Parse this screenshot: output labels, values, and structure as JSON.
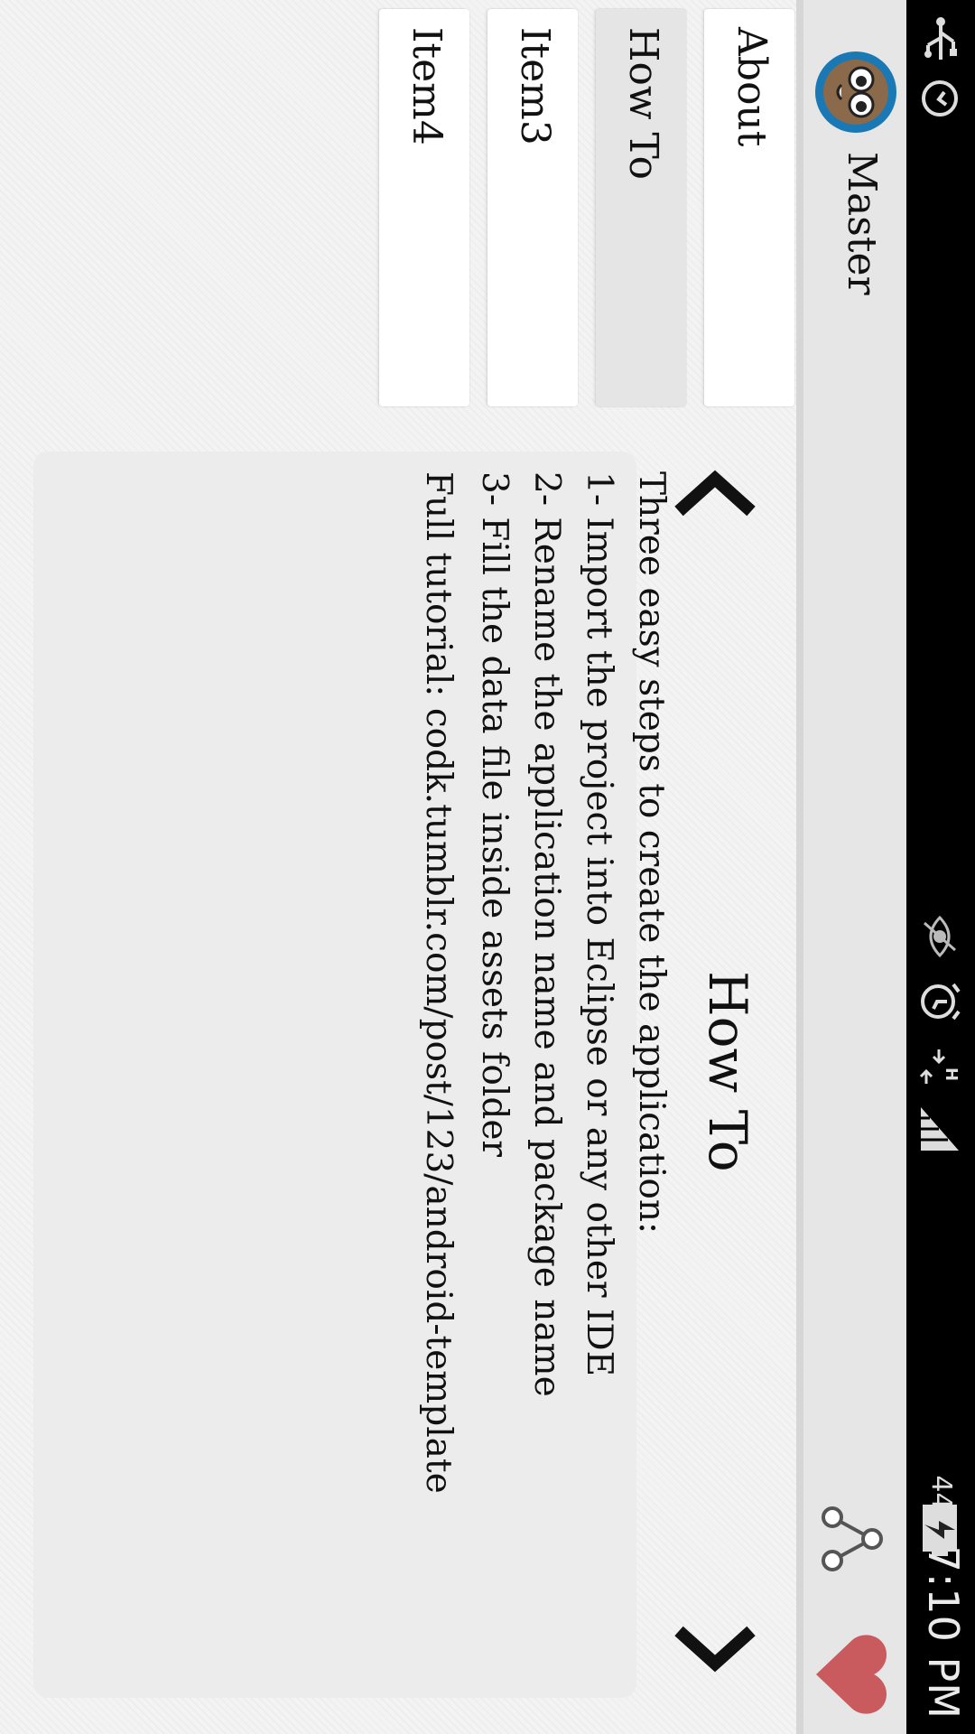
{
  "status_bar": {
    "time": "7:10 PM",
    "battery_percent": "44%",
    "network_type": "H",
    "icons": [
      "usb-icon",
      "sync-icon",
      "eye-icon",
      "alarm-icon",
      "data-arrows-icon",
      "signal-icon",
      "battery-charging-icon"
    ]
  },
  "action_bar": {
    "title": "Master",
    "logo_icon": "owl-logo-icon",
    "actions": [
      "share-icon",
      "favorite-heart-icon"
    ],
    "heart_color": "#c95a5e"
  },
  "drawer": {
    "items": [
      {
        "label": "About",
        "selected": false
      },
      {
        "label": "How To",
        "selected": true
      },
      {
        "label": "Item3",
        "selected": false
      },
      {
        "label": "Item4",
        "selected": false
      }
    ]
  },
  "content": {
    "title": "How To",
    "lines": [
      "Three easy steps to create the application:",
      "1- Import the project into Eclipse or any other IDE",
      "2- Rename the application name and package name",
      "3- Fill the data file inside assets folder"
    ],
    "tutorial": "Full tutorial: codk.tumblr.com/post/123/android-template",
    "nav": {
      "prev_icon": "chevron-left-icon",
      "next_icon": "chevron-right-icon"
    }
  }
}
